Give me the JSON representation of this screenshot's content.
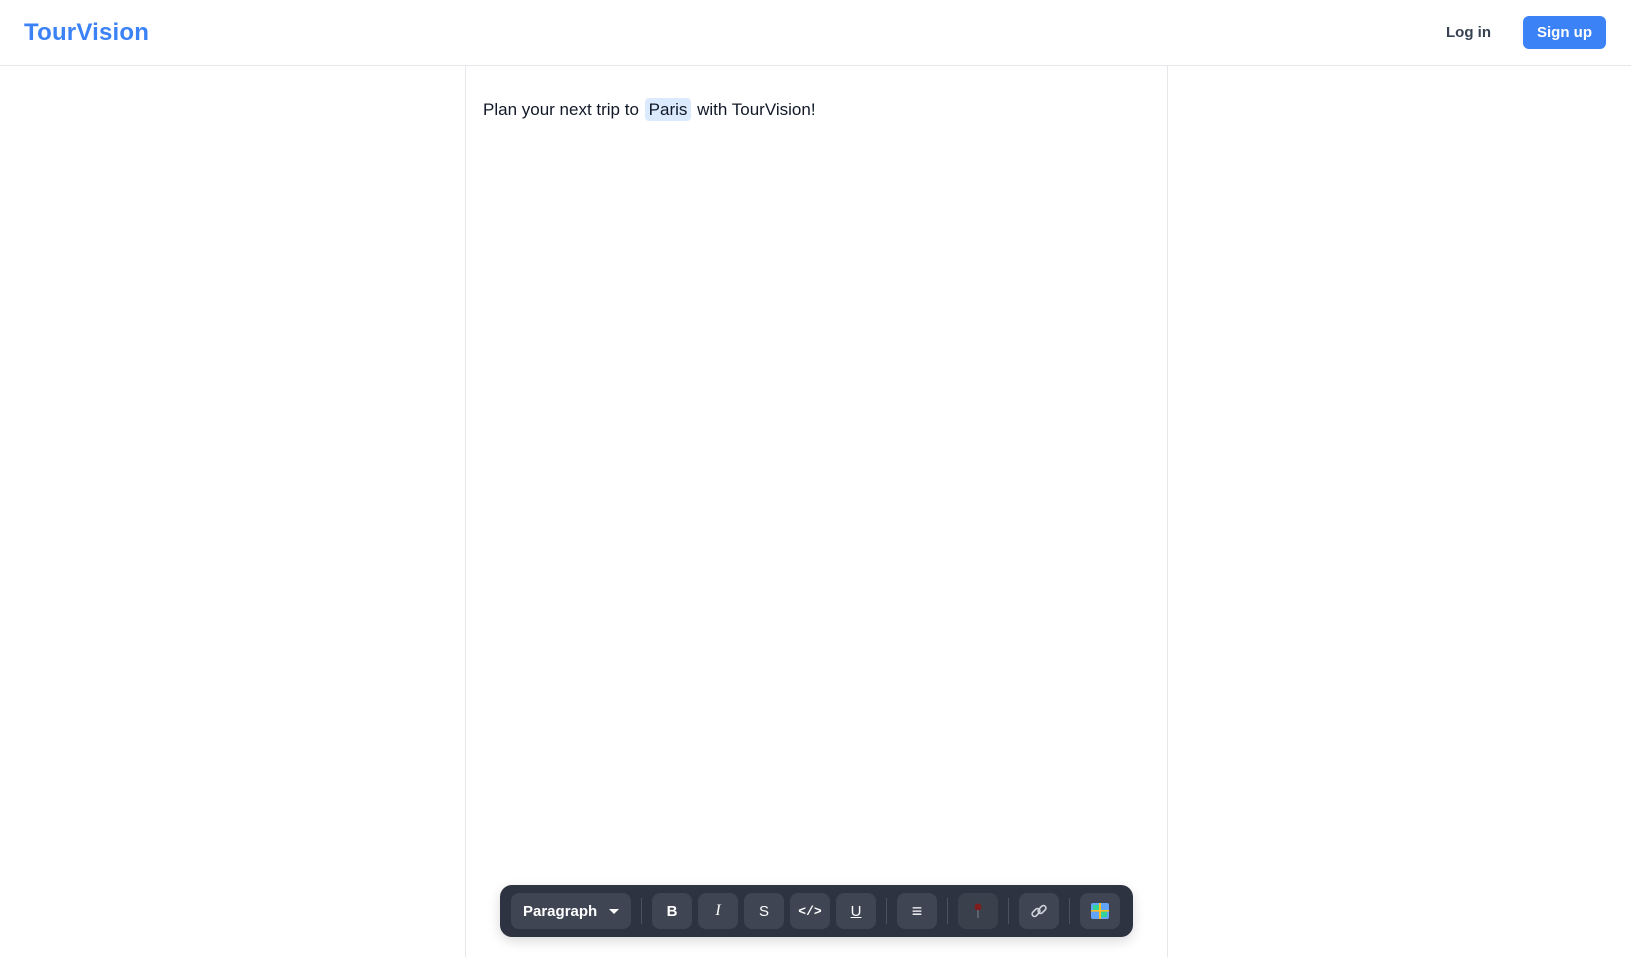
{
  "header": {
    "brand": "TourVision",
    "login_label": "Log in",
    "signup_label": "Sign up",
    "brand_color": "#3b82f6",
    "signup_color": "#3b82f6"
  },
  "editor": {
    "text_before": "Plan your next trip to",
    "mention": "Paris",
    "text_after": "with TourVision!",
    "mention_bg": "#dbeafe"
  },
  "toolbar": {
    "block_type": "Paragraph",
    "bold_label": "B",
    "italic_label": "I",
    "strike_label": "S",
    "code_label": "</>",
    "underline_label": "U",
    "align_label": "≡",
    "icons": [
      "chevron-down-icon",
      "pin-icon",
      "link-icon",
      "map-icon"
    ],
    "background": "#2d3340"
  }
}
